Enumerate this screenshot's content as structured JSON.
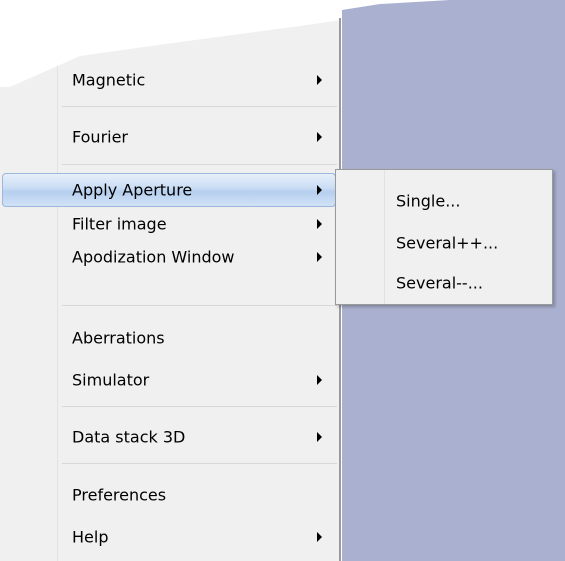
{
  "menu": {
    "items": [
      {
        "label": "Magnetic",
        "submenu": true
      },
      {
        "label": "Fourier",
        "submenu": true
      },
      {
        "label": "Apply Aperture",
        "submenu": true,
        "highlighted": true
      },
      {
        "label": "Filter image",
        "submenu": true
      },
      {
        "label": "Apodization Window",
        "submenu": true
      },
      {
        "label": "Aberrations",
        "submenu": false
      },
      {
        "label": "Simulator",
        "submenu": true
      },
      {
        "label": "Data stack 3D",
        "submenu": true
      },
      {
        "label": "Preferences",
        "submenu": false
      },
      {
        "label": "Help",
        "submenu": true
      }
    ]
  },
  "submenu": {
    "items": [
      {
        "label": "Single..."
      },
      {
        "label": "Several++..."
      },
      {
        "label": "Several--..."
      }
    ]
  },
  "colors": {
    "desktop": "#aab0cf",
    "menu_background": "#f0f0f0",
    "highlight": "#c9dcf4"
  }
}
